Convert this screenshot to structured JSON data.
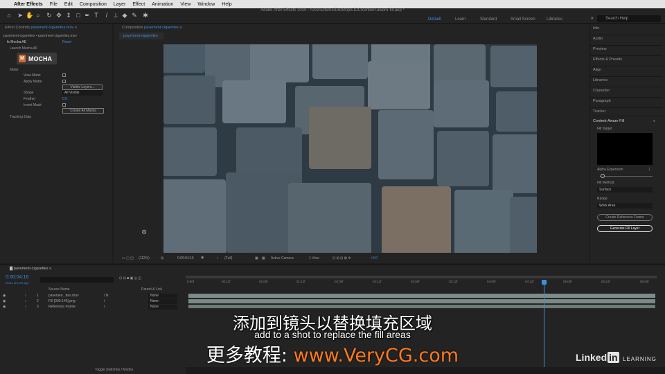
{
  "menubar": {
    "apple": "",
    "app": "After Effects",
    "items": [
      "File",
      "Edit",
      "Composition",
      "Layer",
      "Effect",
      "Animation",
      "View",
      "Window",
      "Help"
    ]
  },
  "doc_title": "Adobe After Effects 2020 - /Users/demo/Desktop/LIDC/content-aware-fill.aep *",
  "workspaces": [
    "Default",
    "Learn",
    "Standard",
    "Small Screen",
    "Libraries"
  ],
  "search_placeholder": "Search Help",
  "effect_controls": {
    "tab": "Effect Controls",
    "tab_file": "pavement-cigarettes.mov",
    "path": "pavement-cigarettes • pavement-cigarettes.mov",
    "fx": "Mocha AE",
    "reset": "Reset",
    "launch": "Launch Mocha All",
    "logo": "MOCHA",
    "matte": "Matte",
    "view_matte": "View Matte",
    "apply_matte": "Apply Matte",
    "visible_layers": "Visible Layers...",
    "shape": "Shape",
    "shape_value": "All Visible",
    "feather": "Feather",
    "feather_value": "0.0",
    "invert": "Invert Mask",
    "create_masks": "Create All Masks",
    "tracking": "Tracking Data"
  },
  "composition": {
    "tab": "Composition",
    "tab_name": "pavement-cigarettes",
    "subtab": "pavement-cigarettes",
    "zoom": "(112%)",
    "time": "0:00:04:16",
    "quality": "(Full)",
    "camera": "Active Camera",
    "view": "1 View",
    "exposure": "+0.0"
  },
  "right_panel": {
    "items": [
      "Info",
      "Audio",
      "Preview",
      "Effects & Presets",
      "Align",
      "Libraries",
      "Character",
      "Paragraph",
      "Tracker"
    ],
    "caf": {
      "title": "Content-Aware Fill",
      "fill_target": "Fill Target",
      "alpha": "Alpha Expansion",
      "alpha_value": "1",
      "fill_method": "Fill Method",
      "method_value": "Surface",
      "range": "Range",
      "range_value": "Work Area",
      "create_ref": "Create Reference Frame",
      "generate": "Generate Fill Layer"
    }
  },
  "timeline": {
    "tab": "pavement-cigarettes",
    "timecode": "0:00:04:16",
    "fps": "00112 (23.976 fps)",
    "col_source": "Source Name",
    "col_parent": "Parent & Link",
    "layers": [
      {
        "num": "1",
        "name": "pavemen...ttes.mov",
        "parent": "None"
      },
      {
        "num": "2",
        "name": "Fill [000-146].png",
        "parent": "None"
      },
      {
        "num": "3",
        "name": "Reference Frame",
        "parent": "None"
      }
    ],
    "ruler": [
      "0:00f",
      "00:12f",
      "01:00f",
      "01:12f",
      "02:00f",
      "02:12f",
      "03:00f",
      "03:12f",
      "04:00f",
      "04:12f",
      "05:00f",
      "05:12f",
      "06:00f"
    ],
    "toggle": "Toggle Switches / Modes"
  },
  "subtitles": {
    "cn": "添加到镜头以替换填充区域",
    "en": "add to a shot to replace the fill areas"
  },
  "watermark": {
    "prefix": "更多教程: ",
    "url": "www.VeryCG.com"
  },
  "brand": {
    "linked": "Linked",
    "in": "in",
    "learning": "LEARNING"
  }
}
